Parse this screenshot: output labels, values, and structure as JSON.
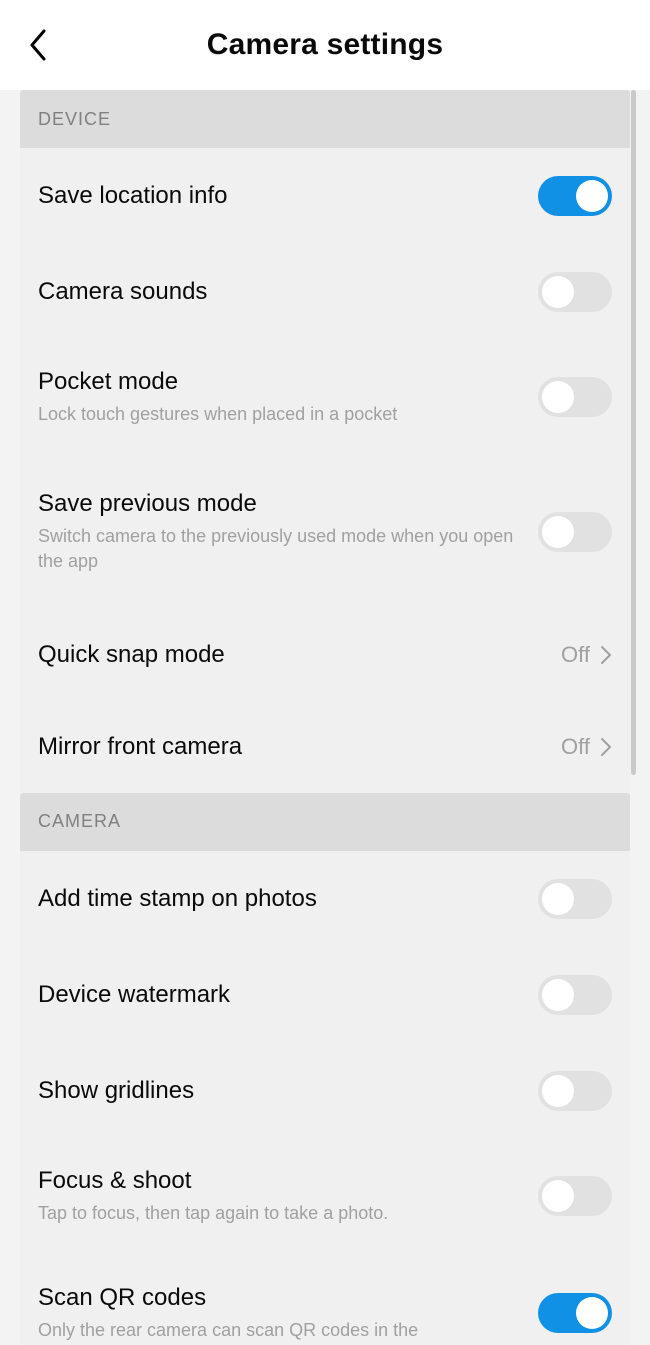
{
  "header": {
    "title": "Camera settings"
  },
  "sections": {
    "device": {
      "label": "DEVICE",
      "save_location": {
        "title": "Save location info",
        "on": true
      },
      "camera_sounds": {
        "title": "Camera sounds",
        "on": false
      },
      "pocket_mode": {
        "title": "Pocket mode",
        "subtitle": "Lock touch gestures when placed in a pocket",
        "on": false
      },
      "save_prev_mode": {
        "title": "Save previous mode",
        "subtitle": "Switch camera to the previously used mode when you open the app",
        "on": false
      },
      "quick_snap": {
        "title": "Quick snap mode",
        "value": "Off"
      },
      "mirror_front": {
        "title": "Mirror front camera",
        "value": "Off"
      }
    },
    "camera": {
      "label": "CAMERA",
      "time_stamp": {
        "title": "Add time stamp on photos",
        "on": false
      },
      "watermark": {
        "title": "Device watermark",
        "on": false
      },
      "gridlines": {
        "title": "Show gridlines",
        "on": false
      },
      "focus_shoot": {
        "title": "Focus & shoot",
        "subtitle": "Tap to focus, then tap again to take a photo.",
        "on": false
      },
      "scan_qr": {
        "title": "Scan QR codes",
        "subtitle": "Only the rear camera can scan QR codes in the",
        "on": true
      }
    }
  }
}
